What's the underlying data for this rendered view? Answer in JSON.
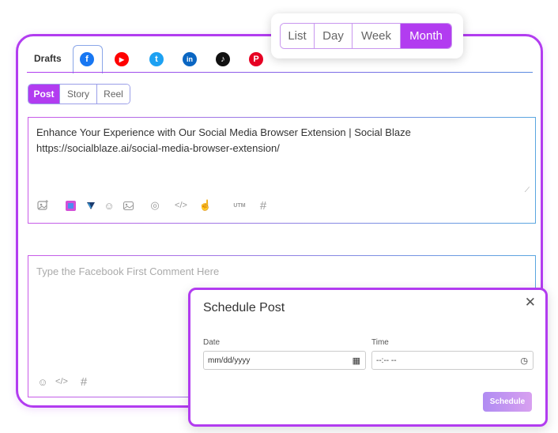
{
  "view_switch": {
    "options": [
      "List",
      "Day",
      "Week",
      "Month"
    ],
    "active": "Month"
  },
  "tabs": {
    "drafts_label": "Drafts",
    "networks": [
      {
        "name": "facebook",
        "glyph": "f",
        "color": "#1877f2"
      },
      {
        "name": "youtube",
        "glyph": "▶",
        "color": "#ff0000"
      },
      {
        "name": "twitter",
        "glyph": "t",
        "color": "#1da1f2"
      },
      {
        "name": "linkedin",
        "glyph": "in",
        "color": "#0a66c2"
      },
      {
        "name": "tiktok",
        "glyph": "♪",
        "color": "#111111"
      },
      {
        "name": "pinterest",
        "glyph": "P",
        "color": "#e60023"
      }
    ],
    "active_network": "facebook"
  },
  "post_type": {
    "options": [
      "Post",
      "Story",
      "Reel"
    ],
    "active": "Post"
  },
  "post_editor": {
    "text": "Enhance Your Experience with Our Social Media Browser Extension | Social Blaze https://socialblaze.ai/social-media-browser-extension/",
    "utm_label": "UTM"
  },
  "comment_editor": {
    "placeholder": "Type the Facebook First Comment Here"
  },
  "schedule_dialog": {
    "title": "Schedule Post",
    "date_label": "Date",
    "date_placeholder": "mm/dd/yyyy",
    "time_label": "Time",
    "time_placeholder": "--:-- --",
    "button_label": "Schedule"
  }
}
